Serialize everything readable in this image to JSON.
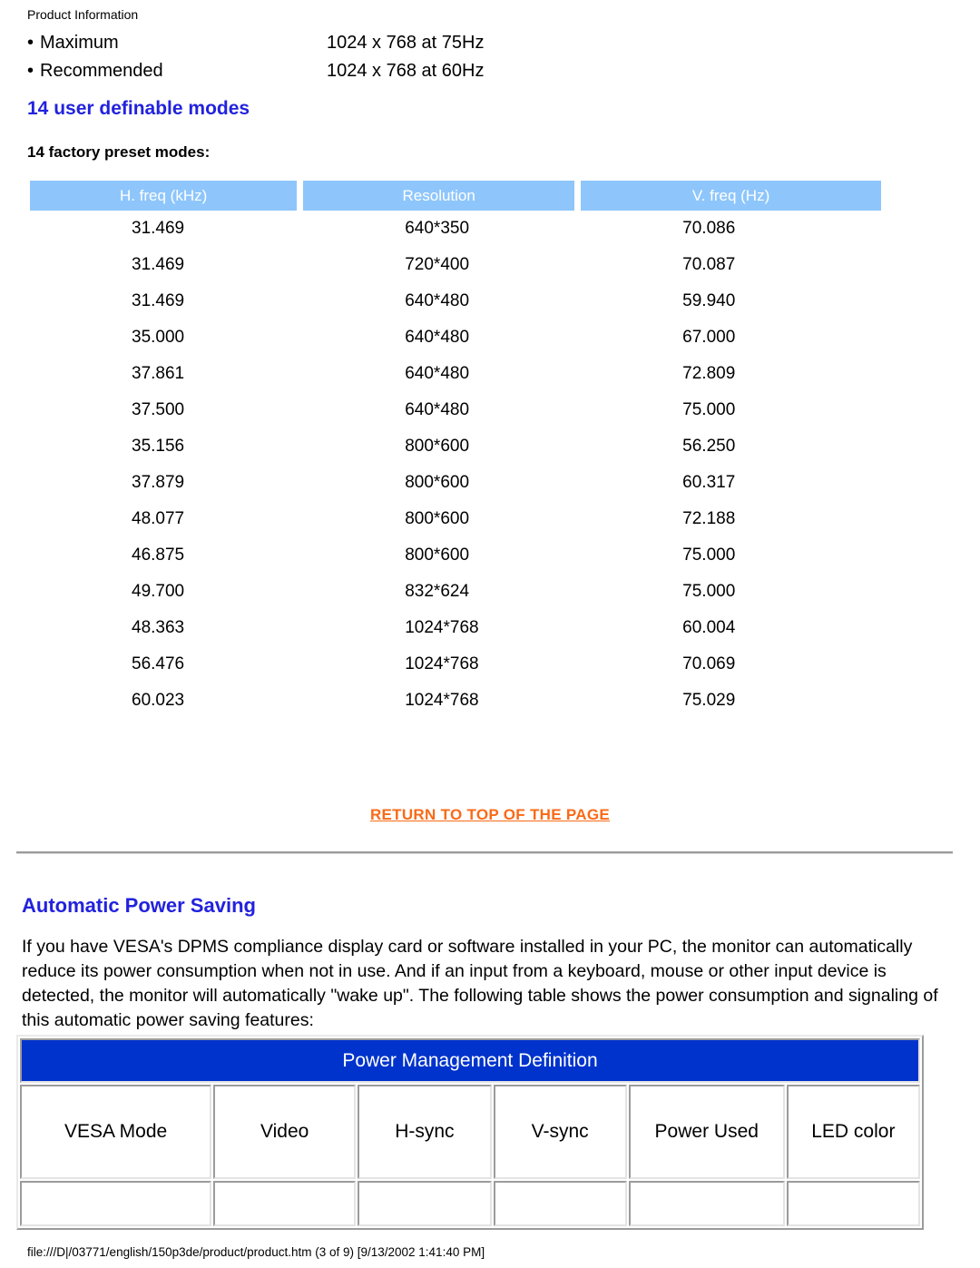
{
  "running_head": "Product Information",
  "specs": [
    {
      "bullet": "•",
      "label": "Maximum",
      "value": "1024 x 768 at 75Hz"
    },
    {
      "bullet": "•",
      "label": "Recommended",
      "value": "1024 x 768 at 60Hz"
    }
  ],
  "user_definable_modes_heading": "14 user definable modes",
  "factory_preset_subheading": "14 factory preset modes:",
  "preset_table": {
    "columns": [
      "H. freq (kHz)",
      "Resolution",
      "V. freq (Hz)"
    ],
    "rows": [
      [
        "31.469",
        "640*350",
        "70.086"
      ],
      [
        "31.469",
        "720*400",
        "70.087"
      ],
      [
        "31.469",
        "640*480",
        "59.940"
      ],
      [
        "35.000",
        "640*480",
        "67.000"
      ],
      [
        "37.861",
        "640*480",
        "72.809"
      ],
      [
        "37.500",
        "640*480",
        "75.000"
      ],
      [
        "35.156",
        "800*600",
        "56.250"
      ],
      [
        "37.879",
        "800*600",
        "60.317"
      ],
      [
        "48.077",
        "800*600",
        "72.188"
      ],
      [
        "46.875",
        "800*600",
        "75.000"
      ],
      [
        "49.700",
        "832*624",
        "75.000"
      ],
      [
        "48.363",
        "1024*768",
        "60.004"
      ],
      [
        "56.476",
        "1024*768",
        "70.069"
      ],
      [
        "60.023",
        "1024*768",
        "75.029"
      ]
    ]
  },
  "return_to_top_label": "RETURN TO TOP OF THE PAGE",
  "automatic_power_saving": {
    "heading": "Automatic Power Saving",
    "paragraph": "If you have VESA's DPMS compliance display card or software installed in your PC, the monitor can automatically reduce its power consumption when not in use. And if an input from a keyboard, mouse or other input device is detected, the monitor will automatically \"wake up\". The following table shows the power consumption and signaling of this automatic power saving features:"
  },
  "power_management_table": {
    "title": "Power Management Definition",
    "columns": [
      "VESA Mode",
      "Video",
      "H-sync",
      "V-sync",
      "Power Used",
      "LED color"
    ]
  },
  "footer_path": "file:///D|/03771/english/150p3de/product/product.htm (3 of 9) [9/13/2002 1:41:40 PM]",
  "colors": {
    "heading_blue": "#2222dd",
    "table_header_blue": "#8EC6FC",
    "pm_title_blue": "#0033CC",
    "return_link_orange": "#f96a17"
  }
}
